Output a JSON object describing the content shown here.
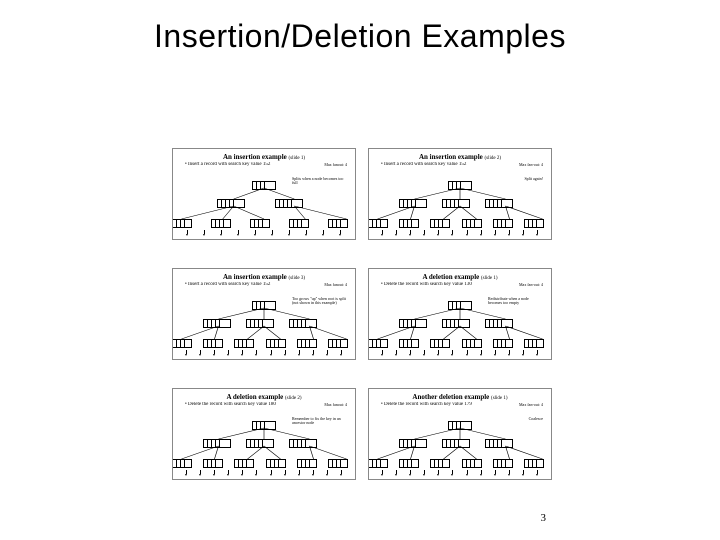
{
  "title": "Insertion/Deletion Examples",
  "page_number": "3",
  "thumbs": [
    {
      "heading": "An insertion example",
      "heading_suffix": "(slide 1)",
      "subtitle": "• Insert a record with search key value 152",
      "note_a": "Max fanout: 4",
      "note_b": "Splits when a node becomes too full",
      "mids": 2,
      "leaves": 5
    },
    {
      "heading": "An insertion example",
      "heading_suffix": "(slide 2)",
      "subtitle": "• Insert a record with search key value 152",
      "note_a": "Max fan-out: 4",
      "note_b": "Split again!",
      "mids": 3,
      "leaves": 6
    },
    {
      "heading": "An insertion example",
      "heading_suffix": "(slide 3)",
      "subtitle": "• Insert a record with search key value 152",
      "note_a": "Max fanout: 4",
      "note_b": "Too grows \"up\" when root is split (not shown in this example)",
      "mids": 3,
      "leaves": 6
    },
    {
      "heading": "A deletion example",
      "heading_suffix": "(slide 1)",
      "subtitle": "• Delete the record with search key value 130",
      "note_a": "Max fan-out: 4",
      "note_b": "Redistribute when a node becomes too empty",
      "mids": 3,
      "leaves": 6
    },
    {
      "heading": "A deletion example",
      "heading_suffix": "(slide 2)",
      "subtitle": "• Delete the record with search key value 180",
      "note_a": "Max fanout: 4",
      "note_b": "Remember to fix the key in an ancestor node",
      "mids": 3,
      "leaves": 6
    },
    {
      "heading": "Another deletion example",
      "heading_suffix": "(slide 1)",
      "subtitle": "• Delete the record with search key value 179",
      "note_a": "Max fan-out: 4",
      "note_b": "Coalesce",
      "mids": 3,
      "leaves": 6
    }
  ]
}
